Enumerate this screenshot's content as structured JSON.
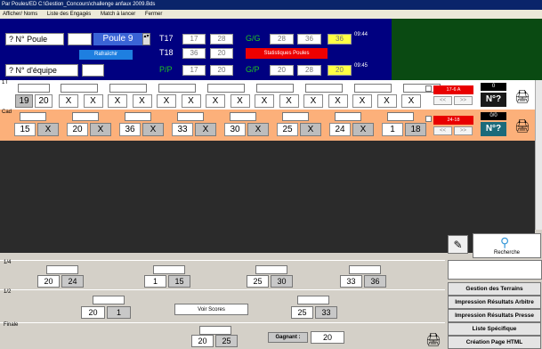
{
  "window": {
    "title": "Par Poules/ED C:\\Gestion_Concours\\challenge anfaux 2009.Bds"
  },
  "menu": [
    "Afficher/ Noms",
    "Liste des Engagés",
    "Match à lancer",
    "Fermer"
  ],
  "header": {
    "poule_label": "? N° Poule",
    "poule_value": "Poule 9",
    "refresh_label": "Rafraîchir",
    "equipe_label": "? N° d'équipe",
    "stats_label": "Statistiques Poules",
    "rows": [
      {
        "name": "T17",
        "a": "17",
        "b": "28"
      },
      {
        "name": "T18",
        "a": "36",
        "b": "20"
      },
      {
        "name": "P/P",
        "a": "17",
        "b": "20"
      }
    ],
    "stats": [
      {
        "name": "G/G",
        "a": "28",
        "b": "36",
        "c": "36",
        "time": "09:44"
      },
      {
        "name": "G/P",
        "a": "20",
        "b": "28",
        "c": "20",
        "time": "09:45"
      }
    ]
  },
  "row1": {
    "label": "1T",
    "first": [
      "19",
      "20"
    ],
    "cells": [
      "X",
      "X",
      "X",
      "X",
      "X",
      "X",
      "X",
      "X",
      "X",
      "X",
      "X",
      "X",
      "X",
      "X",
      "X"
    ],
    "red_label": "17-6 A",
    "nav": [
      "<<",
      ">>"
    ],
    "top_value": "0",
    "nq": "N°?"
  },
  "row2": {
    "label": "Cad",
    "pairs": [
      [
        "15",
        "X"
      ],
      [
        "20",
        "X"
      ],
      [
        "36",
        "X"
      ],
      [
        "33",
        "X"
      ],
      [
        "30",
        "X"
      ],
      [
        "25",
        "X"
      ],
      [
        "24",
        "X"
      ],
      [
        "1",
        "18"
      ]
    ],
    "red_label": "24-18",
    "nav": [
      "<<",
      ">>"
    ],
    "top_value": "0/0",
    "nq": "N°?"
  },
  "bracket": {
    "quarter_label": "1/4",
    "quarters": [
      [
        "20",
        "24"
      ],
      [
        "1",
        "15"
      ],
      [
        "25",
        "30"
      ],
      [
        "33",
        "36"
      ]
    ],
    "semi_label": "1/2",
    "semis": [
      [
        "20",
        "1"
      ],
      [
        "25",
        "33"
      ]
    ],
    "voir_scores": "Voir Scores",
    "final_label": "Finale",
    "final": [
      "20",
      "25"
    ],
    "winner_label": "Gagnant :",
    "winner": "20"
  },
  "right": {
    "recherche": "Recherche",
    "buttons": [
      "Gestion des Terrains",
      "Impression Résultats Arbitre",
      "Impression Résultats Presse",
      "Liste Spécifique",
      "Création Page HTML"
    ]
  }
}
